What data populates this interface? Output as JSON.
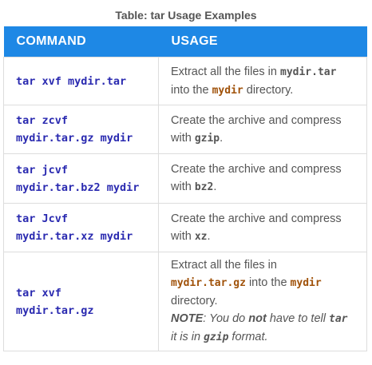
{
  "caption": "Table: tar Usage Examples",
  "headers": {
    "command": "COMMAND",
    "usage": "USAGE"
  },
  "colors": {
    "header_bg": "#1e88e5",
    "command_text": "#2a2ab0",
    "dir_highlight": "#a0520a",
    "usage_text": "#555555"
  },
  "rows": [
    {
      "command_lines": [
        "tar xvf mydir.tar"
      ],
      "usage": {
        "t1": "Extract all the files in ",
        "c1": "mydir.tar",
        "t2": " into the ",
        "c2": "mydir",
        "t3": " directory."
      }
    },
    {
      "command_lines": [
        "tar zcvf",
        "mydir.tar.gz mydir"
      ],
      "usage": {
        "t1": "Create the archive and compress with ",
        "c1": "gzip",
        "t2": "."
      }
    },
    {
      "command_lines": [
        "tar jcvf",
        "mydir.tar.bz2 mydir"
      ],
      "usage": {
        "t1": "Create the archive and compress with ",
        "c1": "bz2",
        "t2": "."
      }
    },
    {
      "command_lines": [
        "tar Jcvf",
        "mydir.tar.xz mydir"
      ],
      "usage": {
        "t1": "Create the archive and compress with ",
        "c1": "xz",
        "t2": "."
      }
    },
    {
      "command_lines": [
        "tar xvf",
        "mydir.tar.gz"
      ],
      "usage": {
        "t1": "Extract all the files in ",
        "c1": "mydir.tar.gz",
        "t2": " into the ",
        "c2": "mydir",
        "t3": " directory.",
        "note_label": "NOTE",
        "note_t1": ": You do ",
        "note_not": "not",
        "note_t2": " have to tell ",
        "note_c1": "tar",
        "note_t3": " it is in ",
        "note_c2": "gzip",
        "note_t4": " format."
      }
    }
  ]
}
